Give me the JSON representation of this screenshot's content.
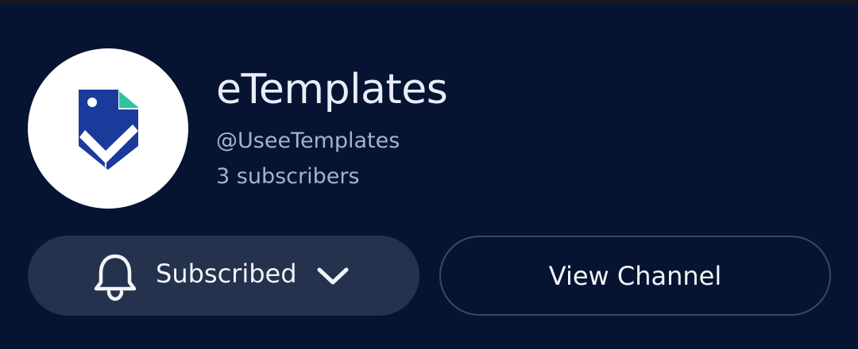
{
  "channel": {
    "name": "eTemplates",
    "handle": "@UseeTemplates",
    "subscribers": "3 subscribers",
    "avatar_icon": "etemplates-logo-icon"
  },
  "actions": {
    "subscribed_label": "Subscribed",
    "view_channel_label": "View Channel"
  },
  "icons": {
    "bell": "bell-icon",
    "chevron": "chevron-down-icon"
  },
  "colors": {
    "background": "#061432",
    "logo_blue": "#1a3b9c",
    "logo_green": "#2ec4a0",
    "subscribed_button_bg": "#25324d",
    "view_button_border": "#3c4763"
  }
}
